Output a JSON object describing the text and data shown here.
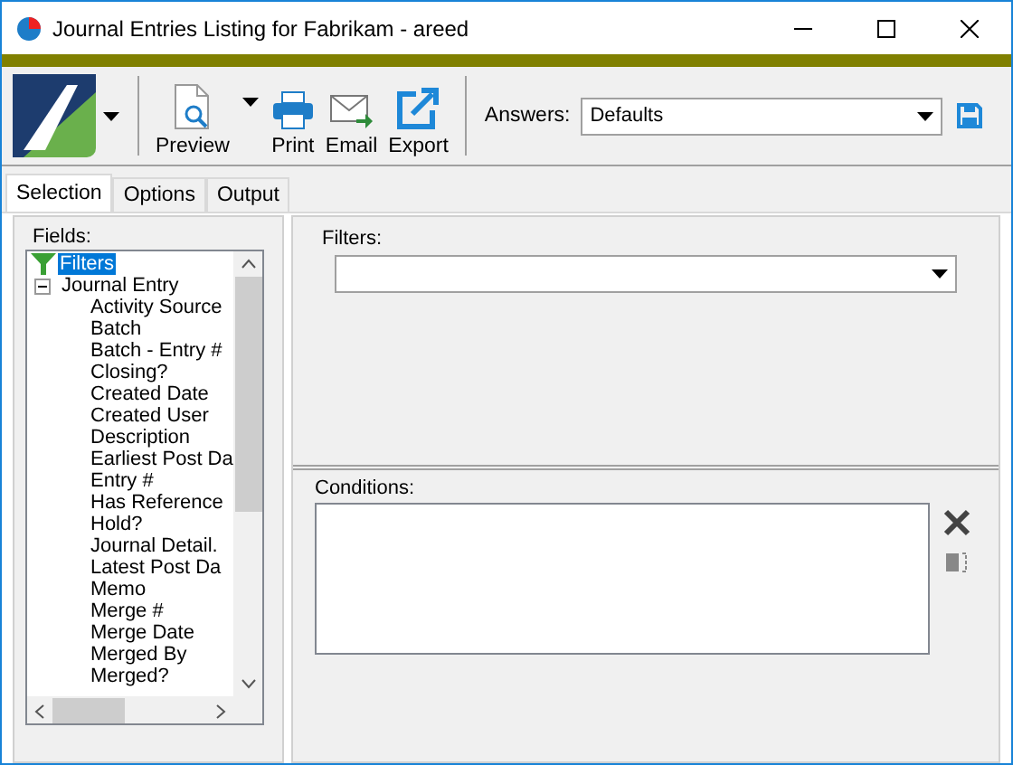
{
  "window": {
    "title": "Journal Entries Listing for Fabrikam - areed"
  },
  "toolbar": {
    "buttons": [
      {
        "label": "Preview",
        "kind": "preview",
        "dropdown": true
      },
      {
        "label": "Print",
        "kind": "print",
        "dropdown": false
      },
      {
        "label": "Email",
        "kind": "email",
        "dropdown": false
      },
      {
        "label": "Export",
        "kind": "export",
        "dropdown": false
      }
    ],
    "answers": {
      "label": "Answers:",
      "value": "Defaults"
    }
  },
  "tabs": [
    {
      "label": "Selection",
      "selected": true
    },
    {
      "label": "Options",
      "selected": false
    },
    {
      "label": "Output",
      "selected": false
    }
  ],
  "fields": {
    "label": "Fields:",
    "tree": [
      {
        "label": "Filters",
        "kind": "filter",
        "selected": true
      },
      {
        "label": "Journal Entry",
        "kind": "group",
        "selected": false,
        "expanded": true,
        "children": [
          {
            "label": "Activity Source",
            "selected": false
          },
          {
            "label": "Batch",
            "selected": false
          },
          {
            "label": "Batch - Entry #",
            "selected": false
          },
          {
            "label": "Closing?",
            "selected": false
          },
          {
            "label": "Created Date",
            "selected": false
          },
          {
            "label": "Created User",
            "selected": false
          },
          {
            "label": "Description",
            "selected": false
          },
          {
            "label": "Earliest Post Da",
            "selected": false
          },
          {
            "label": "Entry #",
            "selected": false
          },
          {
            "label": "Has Reference",
            "selected": false
          },
          {
            "label": "Hold?",
            "selected": false
          },
          {
            "label": "Journal Detail.",
            "selected": false
          },
          {
            "label": "Latest Post Da",
            "selected": false
          },
          {
            "label": "Memo",
            "selected": false
          },
          {
            "label": "Merge #",
            "selected": false
          },
          {
            "label": "Merge Date",
            "selected": false
          },
          {
            "label": "Merged By",
            "selected": false
          },
          {
            "label": "Merged?",
            "selected": false
          }
        ]
      }
    ]
  },
  "filters": {
    "label": "Filters:"
  },
  "conditions": {
    "label": "Conditions:"
  }
}
